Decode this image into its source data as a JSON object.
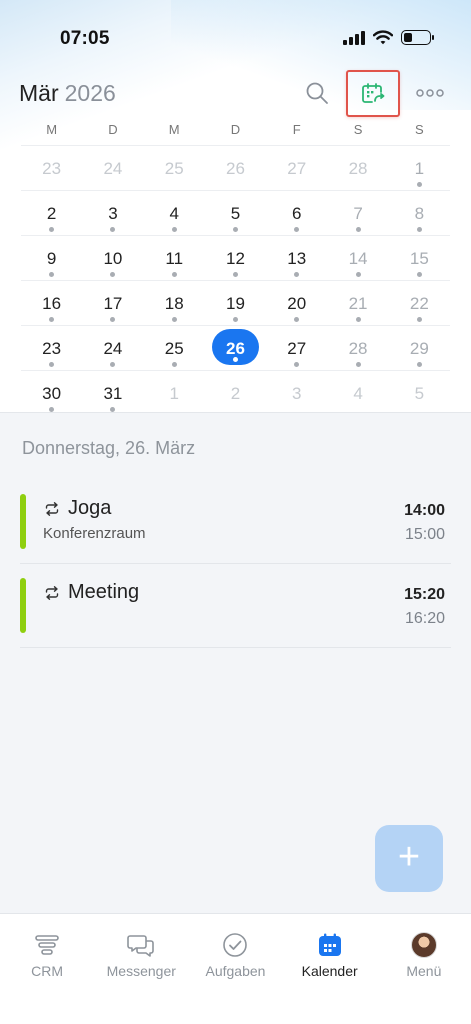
{
  "status": {
    "time": "07:05"
  },
  "header": {
    "month": "Mär",
    "year": "2026"
  },
  "weekdays": [
    "M",
    "D",
    "M",
    "D",
    "F",
    "S",
    "S"
  ],
  "calendar": {
    "weeks": [
      [
        "23",
        "24",
        "25",
        "26",
        "27",
        "28",
        "1"
      ],
      [
        "2",
        "3",
        "4",
        "5",
        "6",
        "7",
        "8"
      ],
      [
        "9",
        "10",
        "11",
        "12",
        "13",
        "14",
        "15"
      ],
      [
        "16",
        "17",
        "18",
        "19",
        "20",
        "21",
        "22"
      ],
      [
        "23",
        "24",
        "25",
        "26",
        "27",
        "28",
        "29"
      ],
      [
        "30",
        "31",
        "1",
        "2",
        "3",
        "4",
        "5"
      ]
    ]
  },
  "selected_date_heading": "Donnerstag, 26. März",
  "events": [
    {
      "title": "Joga",
      "location": "Konferenzraum",
      "start": "14:00",
      "end": "15:00"
    },
    {
      "title": "Meeting",
      "location": "",
      "start": "15:20",
      "end": "16:20"
    }
  ],
  "tabs": [
    {
      "label": "CRM",
      "icon": "crm-funnel-icon"
    },
    {
      "label": "Messenger",
      "icon": "chat-bubbles-icon"
    },
    {
      "label": "Aufgaben",
      "icon": "check-circle-icon"
    },
    {
      "label": "Kalender",
      "icon": "calendar-icon",
      "active": true
    },
    {
      "label": "Menü",
      "icon": "avatar"
    }
  ],
  "colors": {
    "accent": "#1a76f0",
    "event_bar": "#8fcf0f",
    "highlight_border": "#e0544b",
    "sync_icon": "#2bb673"
  }
}
